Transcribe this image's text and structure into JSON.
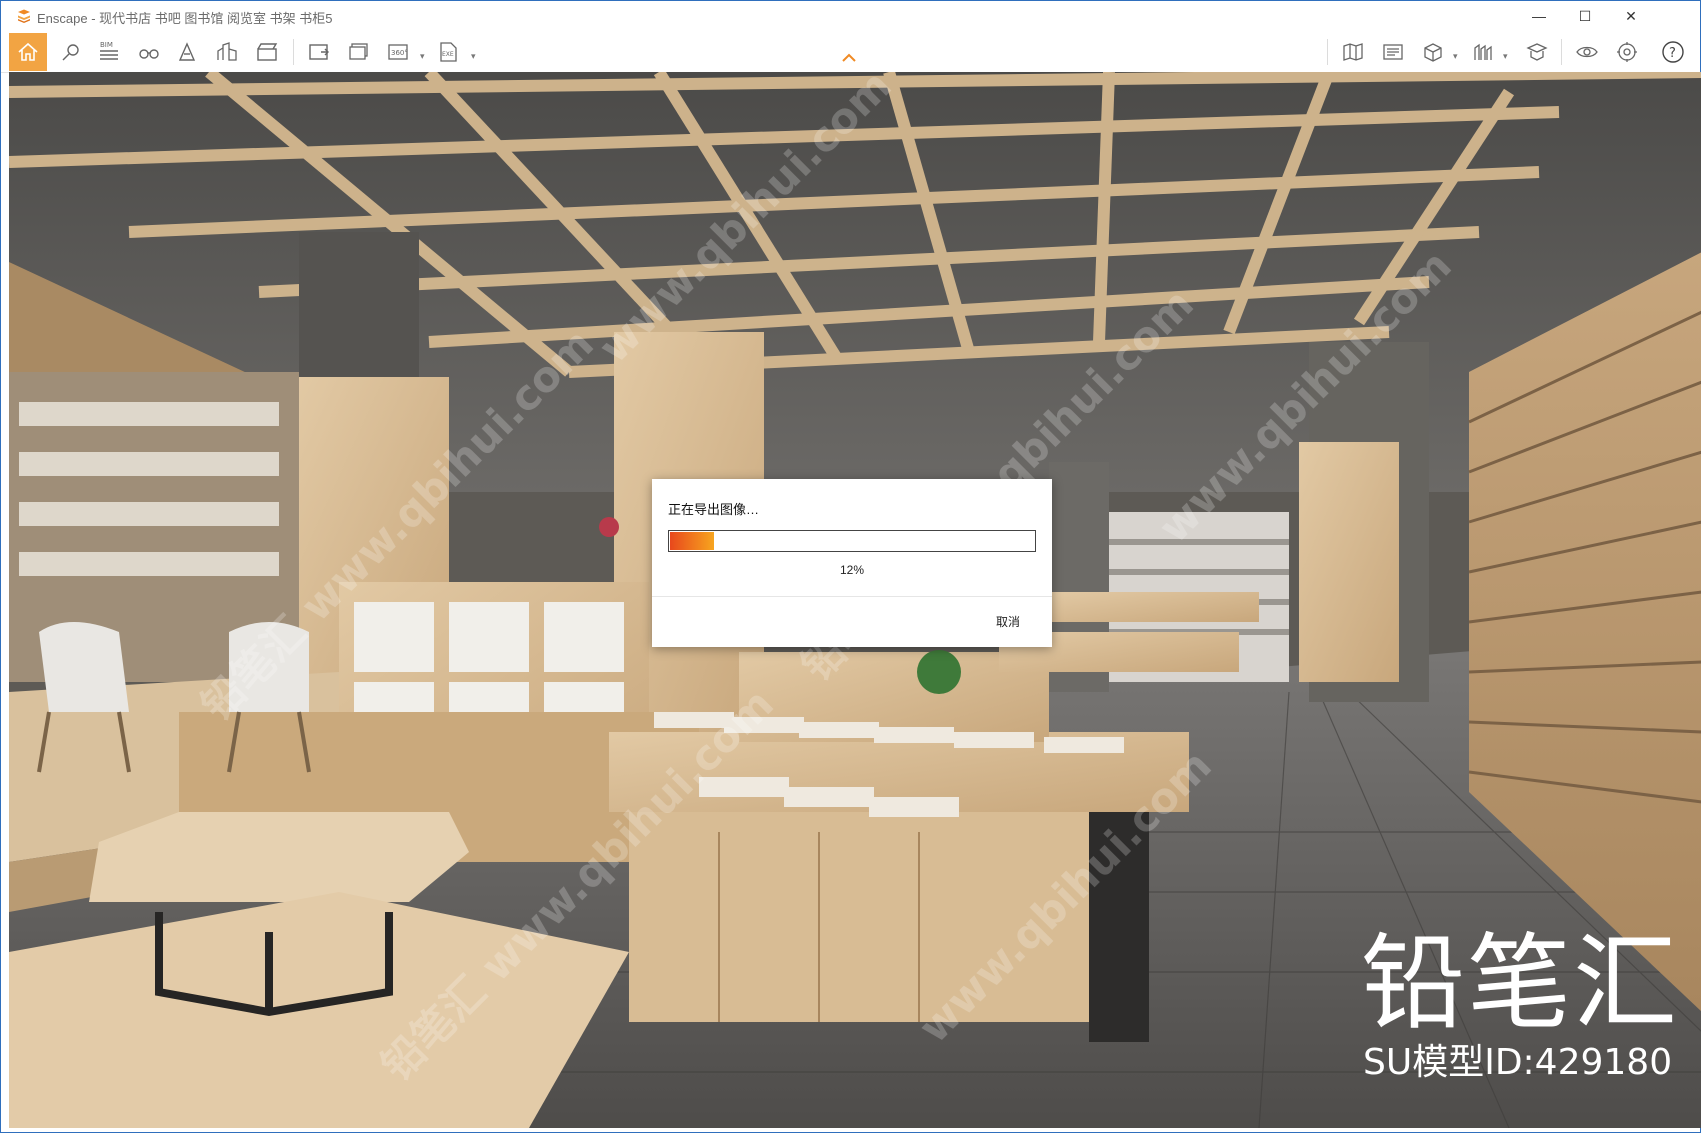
{
  "window": {
    "title": "Enscape - 现代书店 书吧 图书馆 阅览室 书架 书柜5",
    "minimize_glyph": "—",
    "maximize_glyph": "☐",
    "close_glyph": "✕"
  },
  "toolbar": {
    "left_icons": [
      "home-icon",
      "view-settings-icon",
      "bim-icon",
      "binoculars-icon",
      "asset-library-icon",
      "atlas-icon",
      "video-editor-icon",
      "screenshot-icon",
      "batch-render-icon",
      "panorama-360-icon",
      "export-exe-icon"
    ],
    "right_icons": [
      "map-icon",
      "web-standalone-icon",
      "box-view-icon",
      "site-context-icon",
      "material-icon",
      "vr-headset-icon",
      "feedback-icon",
      "help-icon"
    ],
    "bim_label": "BIM",
    "panorama_label": "360°",
    "exe_label": "EXE",
    "help_glyph": "?",
    "accent": "#f2a443"
  },
  "dialog": {
    "title": "正在导出图像…",
    "progress": 0.12,
    "progress_text": "12%",
    "cancel_label": "取消"
  },
  "watermark": {
    "brand": "铅笔汇",
    "model_id": "SU模型ID:429180",
    "diagonal": [
      "www.qbihui.com",
      "铅笔汇 www.qbihui.com"
    ]
  }
}
